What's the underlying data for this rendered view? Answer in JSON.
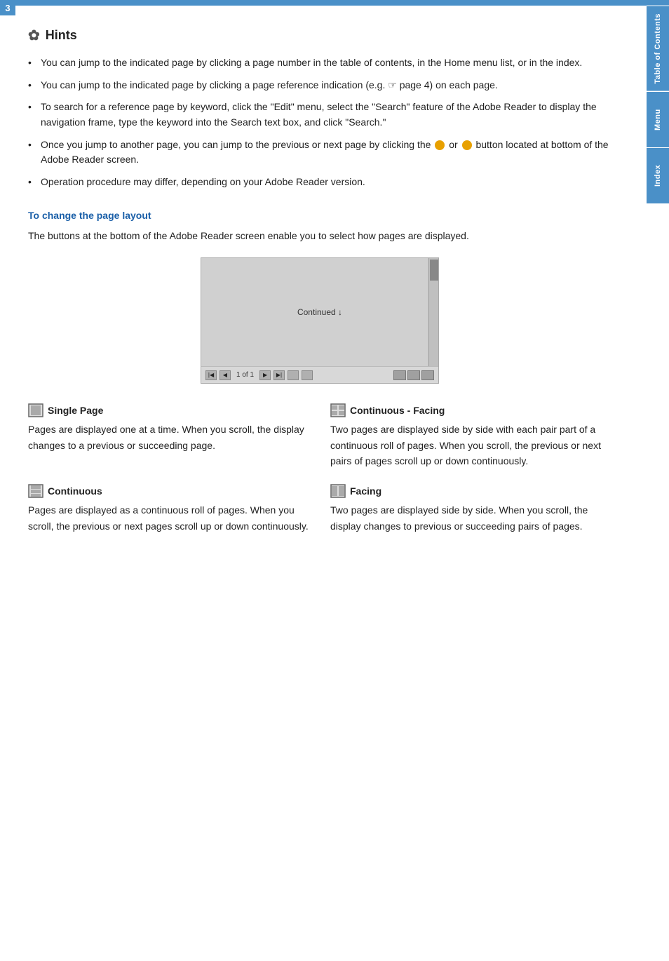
{
  "page": {
    "number": "3",
    "top_bar_color": "#4a90c8"
  },
  "sidebar": {
    "tabs": [
      {
        "id": "table-of-contents",
        "label": "Table of Contents"
      },
      {
        "id": "menu",
        "label": "Menu"
      },
      {
        "id": "index",
        "label": "Index"
      }
    ]
  },
  "hints": {
    "title": "Hints",
    "icon_label": "hints-icon",
    "items": [
      "You can jump to the indicated page by clicking a page number in the table of contents, in the Home menu list, or in the index.",
      "You can jump to the indicated page by clicking a page reference indication (e.g. ☞ page 4) on each page.",
      "To search for a reference page by keyword, click the \"Edit\" menu, select the \"Search\" feature of the Adobe Reader to display the navigation frame, type the keyword into the Search text box, and click \"Search.\"",
      "Once you jump to another page, you can jump to the previous or next page by clicking the ● or ● button located at bottom of the Adobe Reader screen.",
      "Operation procedure may differ, depending on your Adobe Reader version."
    ]
  },
  "section": {
    "heading": "To change the page layout",
    "description": "The buttons at the bottom of the Adobe Reader screen enable you to select how pages are displayed."
  },
  "reader_screenshot": {
    "continued_text": "Continued ↓",
    "toolbar": {
      "page_info": "1 of 1"
    }
  },
  "page_modes": [
    {
      "id": "single-page",
      "title": "Single Page",
      "description": "Pages are displayed one at a time. When you scroll, the display changes to a previous or succeeding page."
    },
    {
      "id": "continuous-facing",
      "title": "Continuous - Facing",
      "description": "Two pages are displayed side by side with each pair part of a continuous roll of pages. When you scroll, the previous or next pairs of pages scroll up or down continuously."
    },
    {
      "id": "continuous",
      "title": "Continuous",
      "description": "Pages are displayed as a continuous roll of pages. When you scroll, the previous or next pages scroll up or down continuously."
    },
    {
      "id": "facing",
      "title": "Facing",
      "description": "Two pages are displayed side by side. When you scroll, the display changes to previous or succeeding pairs of pages."
    }
  ]
}
